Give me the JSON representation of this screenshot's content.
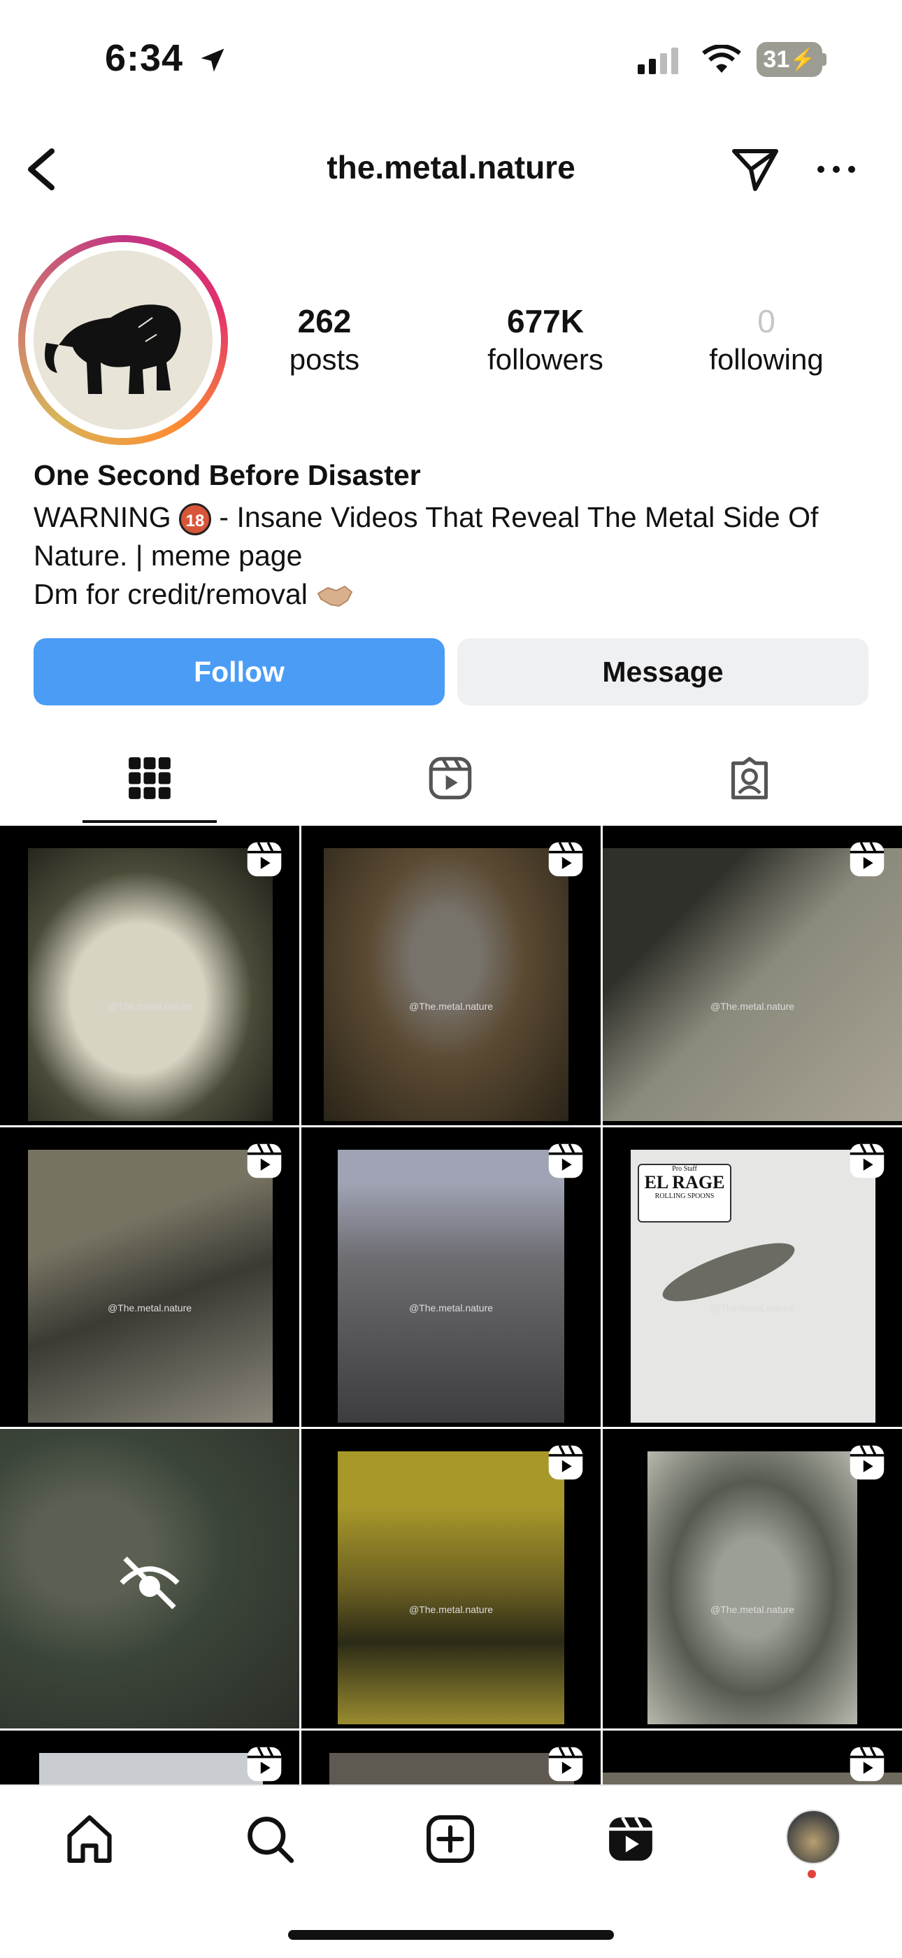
{
  "status_bar": {
    "time": "6:34",
    "battery": "31"
  },
  "header": {
    "username": "the.metal.nature"
  },
  "profile": {
    "stats": [
      {
        "value": "262",
        "label": "posts"
      },
      {
        "value": "677K",
        "label": "followers"
      },
      {
        "value": "0",
        "label": "following"
      }
    ],
    "display_name": "One Second Before Disaster",
    "bio": {
      "line1_pre": "WARNING ",
      "line1_emoji": "18",
      "line1_post": " - Insane Videos That Reveal The Metal Side Of",
      "line2": "Nature. | meme page",
      "line3": "Dm for credit/removal "
    }
  },
  "actions": {
    "follow_label": "Follow",
    "message_label": "Message"
  },
  "tabs": [
    "grid-tab",
    "reels-tab",
    "tagged-tab"
  ],
  "grid": {
    "watermark": "@The.metal.nature",
    "tiles": [
      {
        "name": "dogs-night",
        "color": "#3a3a33"
      },
      {
        "name": "hawk-prey",
        "color": "#5b4a33"
      },
      {
        "name": "crocodile",
        "color": "#6e6e62"
      },
      {
        "name": "monitor-lizard",
        "color": "#5a5750"
      },
      {
        "name": "elephant-fog",
        "color": "#55545a"
      },
      {
        "name": "fish-snake-sign",
        "color": "#cfd0d0"
      },
      {
        "name": "hidden-post",
        "color": "#3c453a"
      },
      {
        "name": "yellow-forest",
        "color": "#8a7a28"
      },
      {
        "name": "snake-leaves",
        "color": "#7a7e70"
      }
    ],
    "sign_text": {
      "brand_top": "Pro Staff",
      "brand_main": "EL RAGE",
      "brand_sub": "ROLLING SPOONS"
    }
  },
  "nav": [
    "home-icon",
    "search-icon",
    "create-icon",
    "reels-icon",
    "profile-avatar"
  ],
  "colors": {
    "accent": "#4a9cf5",
    "secondary_button": "#eff0f2",
    "notification_dot": "#e0443c"
  }
}
